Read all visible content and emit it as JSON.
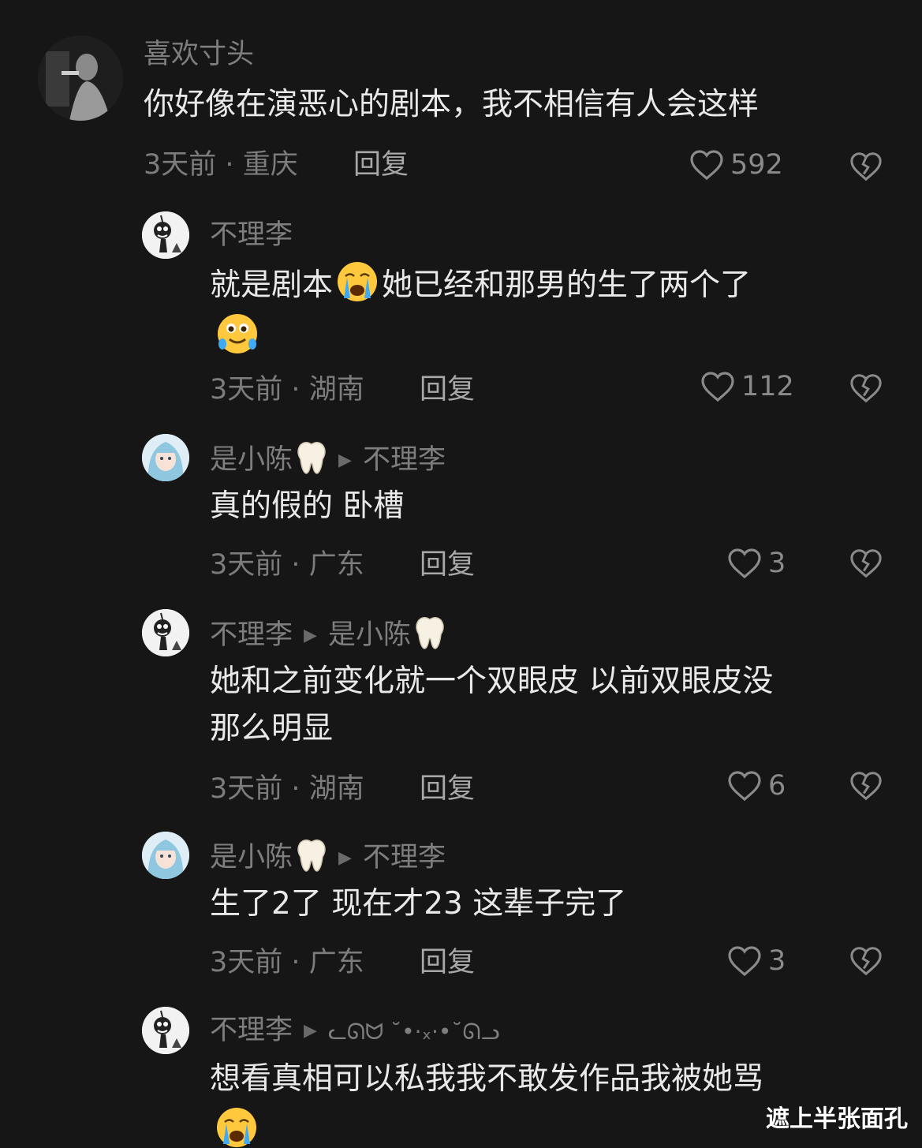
{
  "comments": [
    {
      "username": "喜欢寸头",
      "text": "你好像在演恶心的剧本，我不相信有人会这样",
      "time": "3天前",
      "location": "重庆",
      "reply_label": "回复",
      "likes": "592"
    },
    {
      "username": "不理李",
      "text_part1": "就是剧本",
      "text_part2": "她已经和那男的生了两个了",
      "time": "3天前",
      "location": "湖南",
      "reply_label": "回复",
      "likes": "112"
    },
    {
      "username": "是小陈",
      "reply_to": "不理李",
      "text": "真的假的 卧槽",
      "time": "3天前",
      "location": "广东",
      "reply_label": "回复",
      "likes": "3"
    },
    {
      "username": "不理李",
      "reply_to": "是小陈",
      "text_line1": "她和之前变化就一个双眼皮 以前双眼皮没",
      "text_line2": "那么明显",
      "time": "3天前",
      "location": "湖南",
      "reply_label": "回复",
      "likes": "6"
    },
    {
      "username": "是小陈",
      "reply_to": "不理李",
      "text": "生了2了 现在才23 这辈子完了",
      "time": "3天前",
      "location": "广东",
      "reply_label": "回复",
      "likes": "3"
    },
    {
      "username": "不理李",
      "reply_to": "ᓚᘏᗢ ˘•·ₓ·•˘ᘏᓗ",
      "text": "想看真相可以私我我不敢发作品我被她骂"
    }
  ],
  "separator": "·",
  "watermark": "遮上半张面孔",
  "colors": {
    "background": "#161616",
    "text": "#e9e9e9",
    "muted": "#7e7e7e"
  },
  "icons": [
    "heart-icon",
    "broken-heart-icon",
    "crying-emoji",
    "teary-smile-emoji",
    "tooth-emoji",
    "play-arrow-icon"
  ]
}
